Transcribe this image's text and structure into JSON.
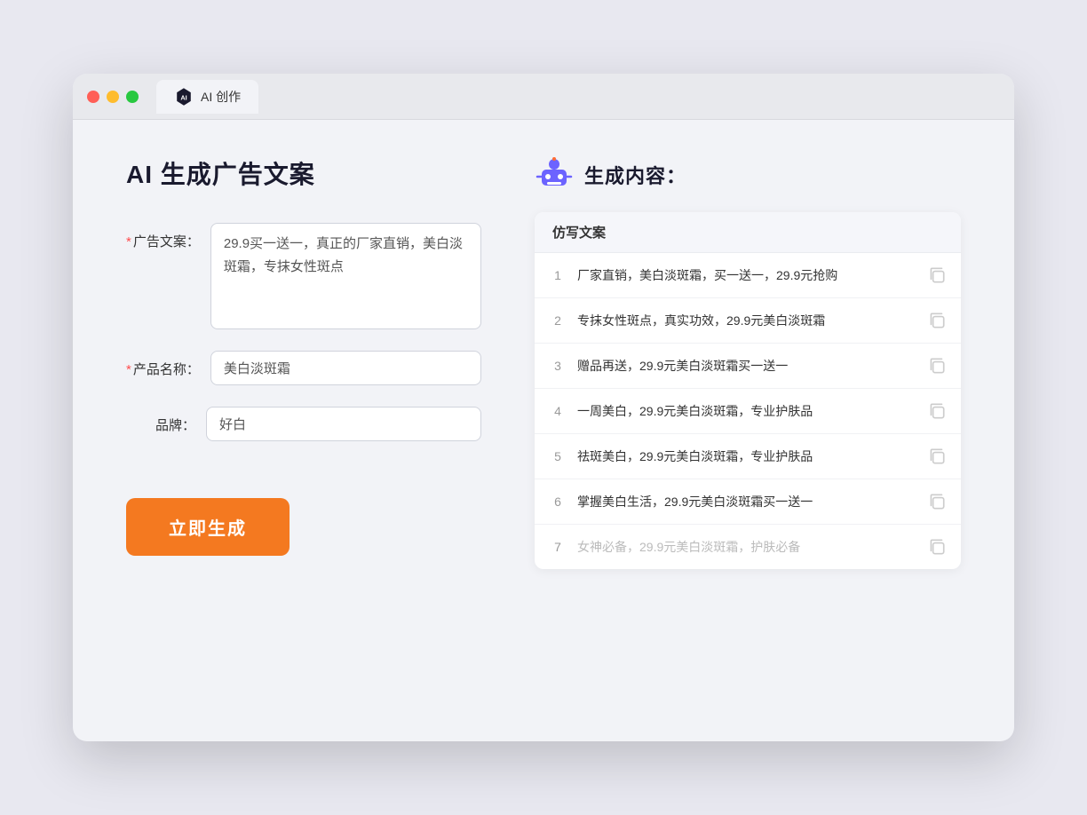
{
  "browser": {
    "tab_label": "AI 创作"
  },
  "page": {
    "title": "AI 生成广告文案",
    "result_title": "生成内容："
  },
  "form": {
    "ad_copy_label": "广告文案：",
    "ad_copy_value": "29.9买一送一，真正的厂家直销，美白淡斑霜，专抹女性斑点",
    "product_name_label": "产品名称：",
    "product_name_value": "美白淡斑霜",
    "brand_label": "品牌：",
    "brand_value": "好白",
    "generate_btn": "立即生成"
  },
  "results": {
    "table_header": "仿写文案",
    "rows": [
      {
        "num": "1",
        "text": "厂家直销，美白淡斑霜，买一送一，29.9元抢购",
        "muted": false
      },
      {
        "num": "2",
        "text": "专抹女性斑点，真实功效，29.9元美白淡斑霜",
        "muted": false
      },
      {
        "num": "3",
        "text": "赠品再送，29.9元美白淡斑霜买一送一",
        "muted": false
      },
      {
        "num": "4",
        "text": "一周美白，29.9元美白淡斑霜，专业护肤品",
        "muted": false
      },
      {
        "num": "5",
        "text": "祛斑美白，29.9元美白淡斑霜，专业护肤品",
        "muted": false
      },
      {
        "num": "6",
        "text": "掌握美白生活，29.9元美白淡斑霜买一送一",
        "muted": false
      },
      {
        "num": "7",
        "text": "女神必备，29.9元美白淡斑霜，护肤必备",
        "muted": true
      }
    ]
  }
}
